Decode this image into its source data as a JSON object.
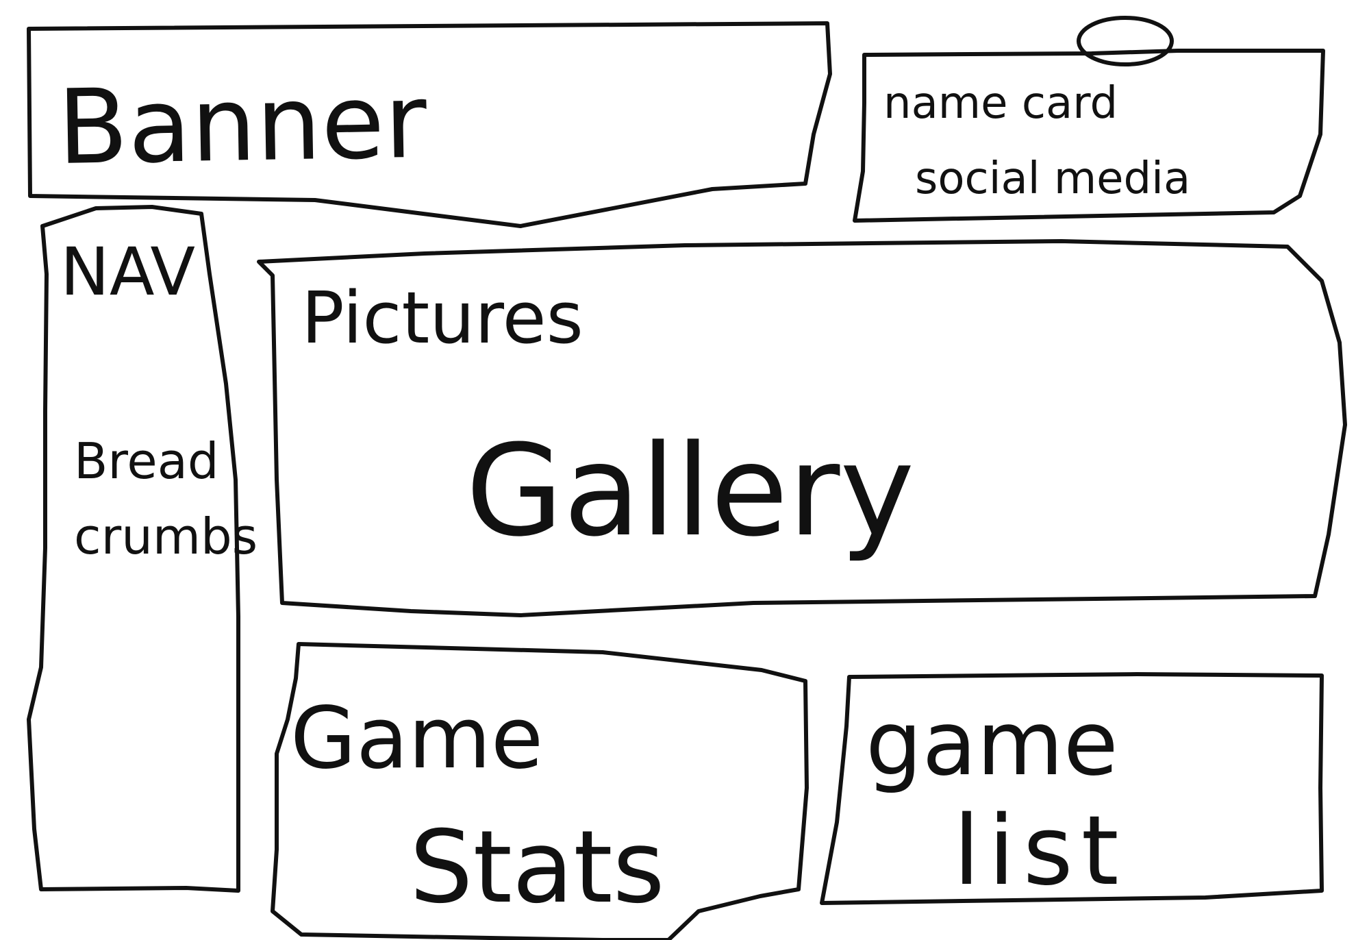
{
  "banner": {
    "label": "Banner"
  },
  "name_card": {
    "line1": "name card",
    "line2": "social media"
  },
  "nav": {
    "label": "NAV",
    "breadcrumbs_line1": "Bread",
    "breadcrumbs_line2": "crumbs"
  },
  "gallery": {
    "label_small": "Pictures",
    "label_large": "Gallery"
  },
  "game_stats": {
    "line1": "Game",
    "line2": "Stats"
  },
  "game_list": {
    "line1": "game",
    "line2": "list"
  },
  "colors": {
    "ink": "#111111",
    "paper": "#ffffff"
  }
}
